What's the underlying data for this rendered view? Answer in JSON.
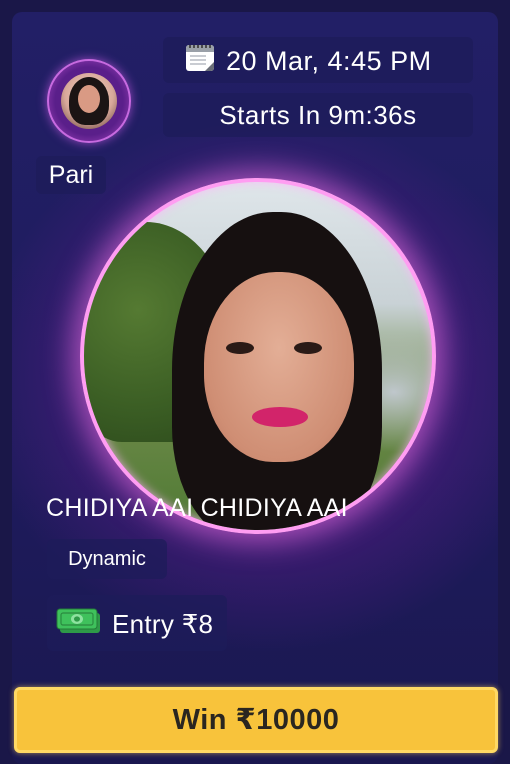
{
  "host": {
    "name": "Pari"
  },
  "schedule": {
    "date_time": "20 Mar, 4:45 PM",
    "starts_in": "Starts In 9m:36s"
  },
  "contest": {
    "title": "CHIDIYA AAI CHIDIYA AAI",
    "tag": "Dynamic",
    "entry": "Entry ₹8",
    "win_label": "Win ₹10000"
  },
  "icons": {
    "calendar": "calendar-icon",
    "money": "banknote-icon"
  },
  "colors": {
    "background": "#1a1748",
    "accent_glow": "#ff9df2",
    "win_button": "#f8c33b"
  }
}
